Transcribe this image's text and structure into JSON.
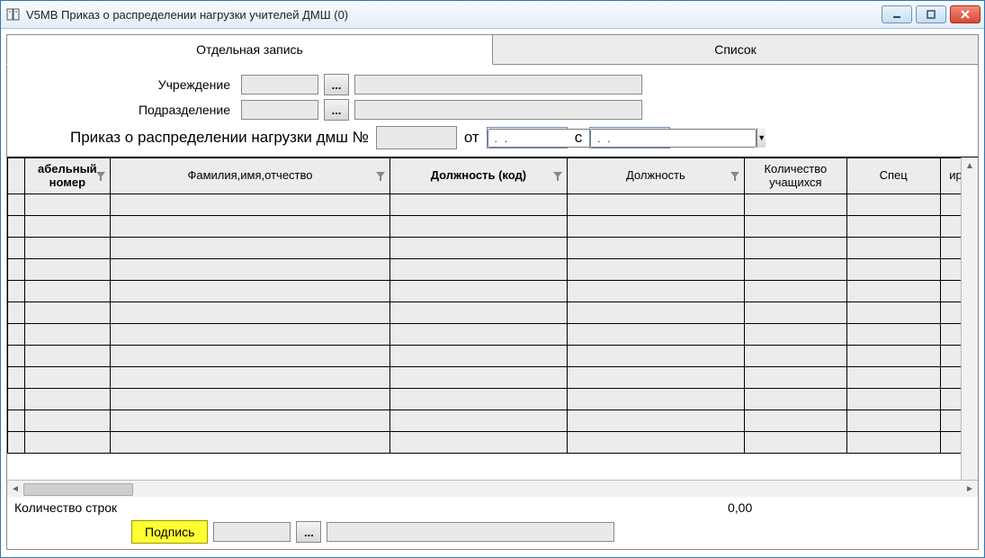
{
  "window": {
    "title": "V5MB Приказ о распределении нагрузки учителей ДМШ (0)"
  },
  "tabs": {
    "single": "Отдельная запись",
    "list": "Список"
  },
  "form": {
    "org_label": "Учреждение",
    "dept_label": "Подразделение",
    "org_combo": "",
    "org_text": "",
    "dept_combo": "",
    "dept_text": ""
  },
  "order": {
    "prefix": "Приказ о распределении нагрузки дмш №",
    "number": "",
    "from_label": "от",
    "from_date": " .  .    ",
    "since_label": "с",
    "since_date": " .  .    "
  },
  "grid": {
    "columns": {
      "tabno": "абельный номер",
      "fio": "Фамилия,имя,отчество",
      "post_code": "Должность (код)",
      "post": "Должность",
      "students": "Количество учащихся",
      "spec": "Спец",
      "tail": "ирс"
    },
    "rows": 12
  },
  "footer": {
    "row_count_label": "Количество строк",
    "row_count_value": "0,00",
    "sign_label": "Подпись",
    "sign_combo": "",
    "sign_text": ""
  },
  "glyphs": {
    "ellipsis": "...",
    "dropdown": "▼",
    "left": "◄",
    "right": "►",
    "up": "▲"
  }
}
